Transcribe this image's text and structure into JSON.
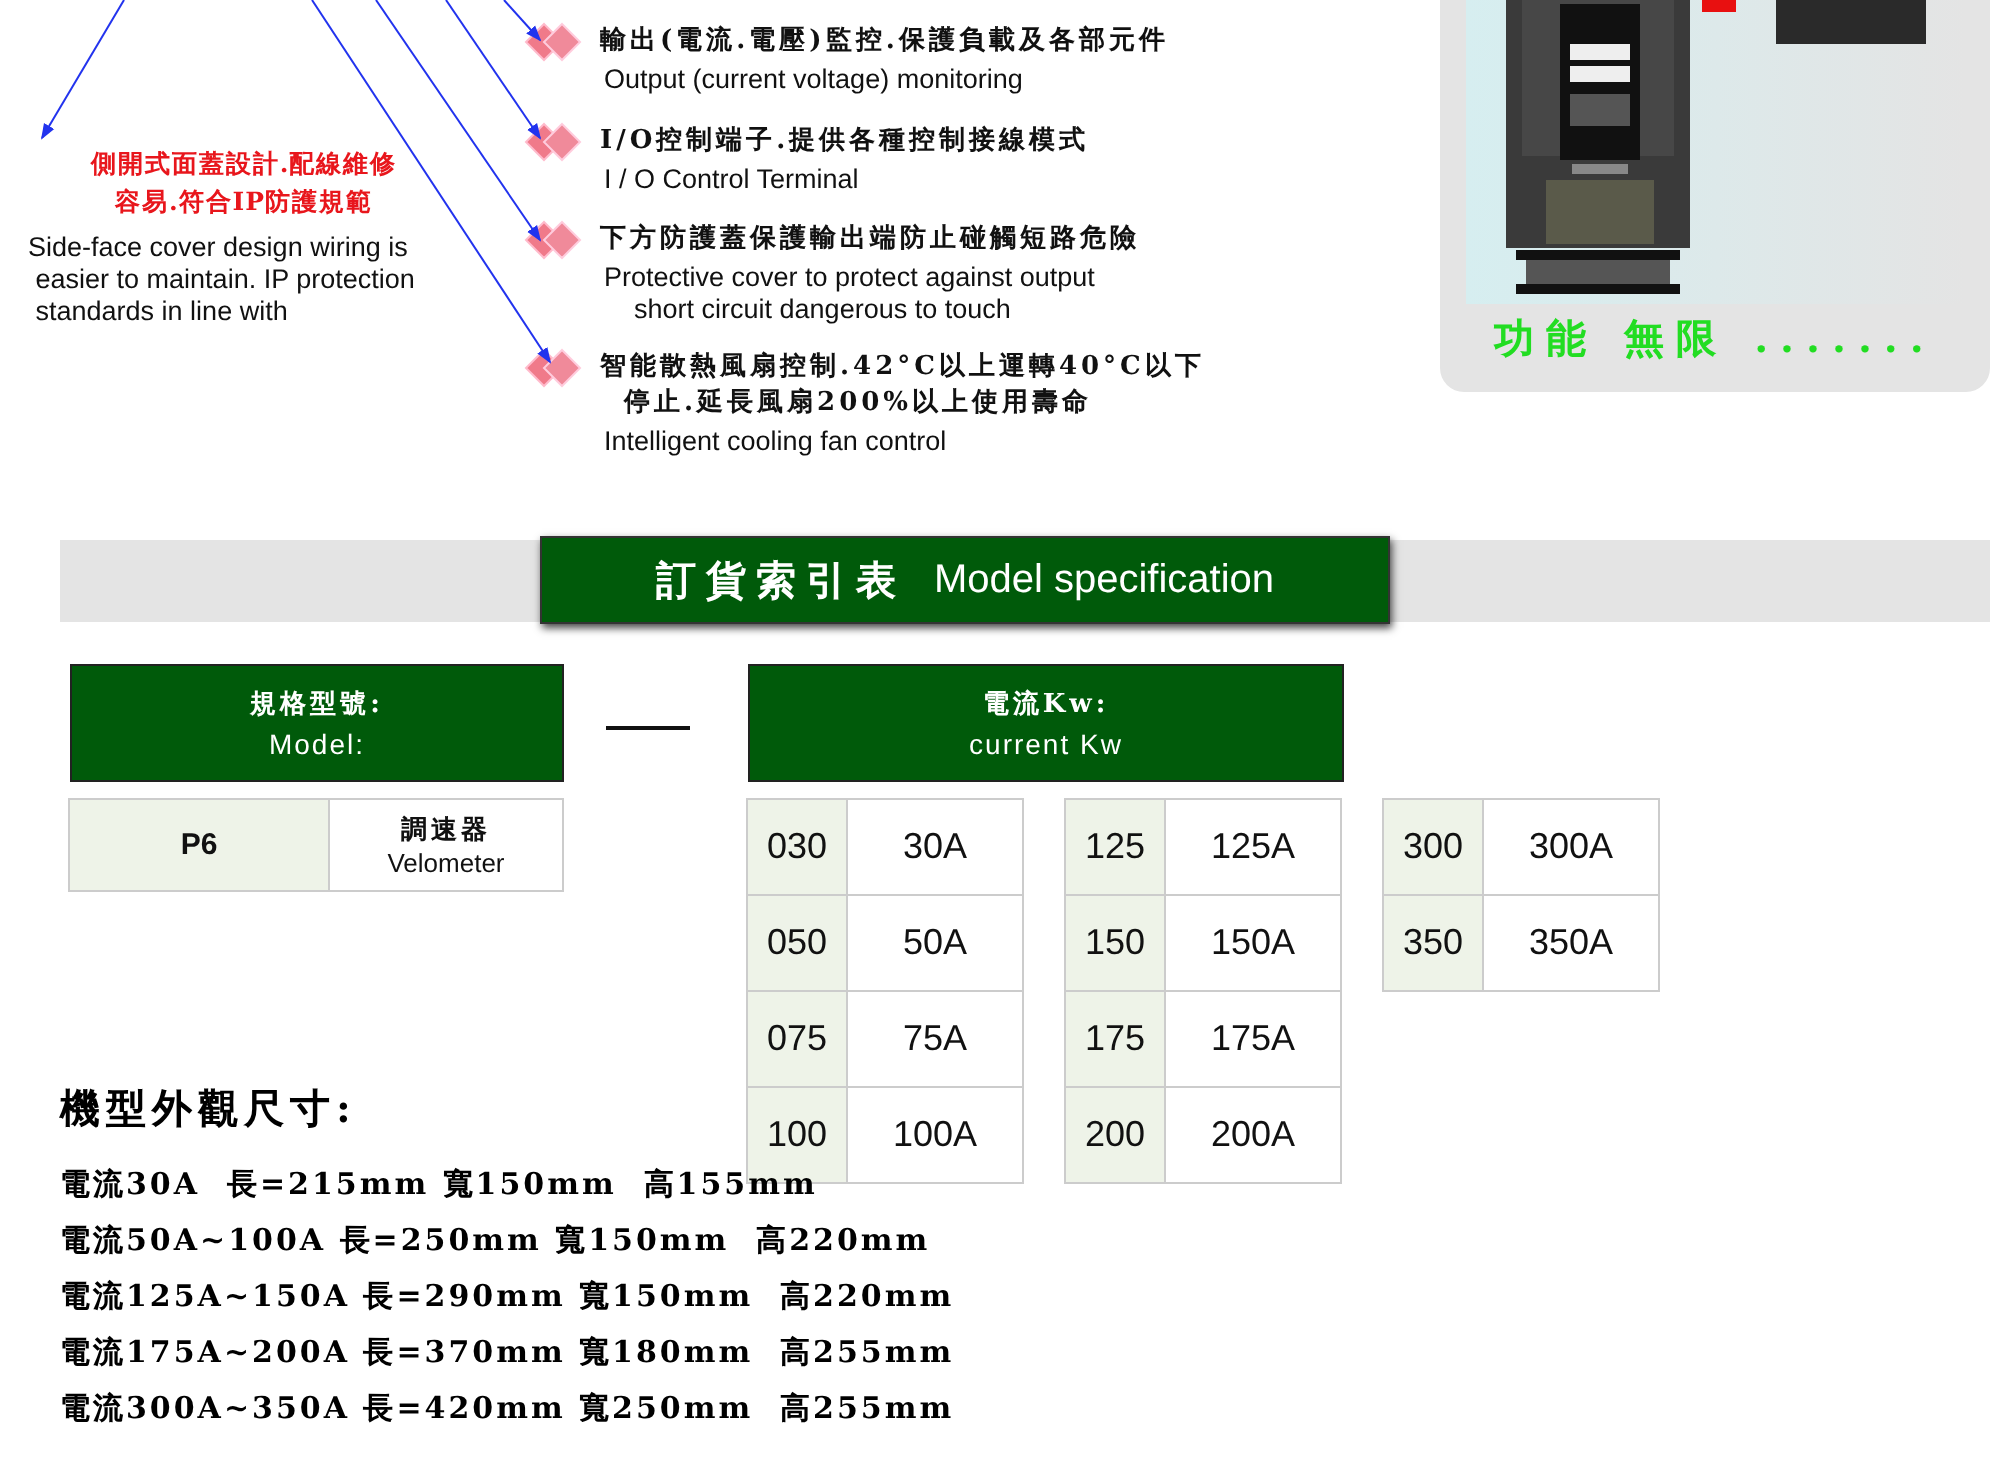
{
  "side_note": {
    "title_lines": [
      "側開式面蓋設計.配線維修",
      "容易.符合IP防護規範"
    ],
    "english": "Side-face cover design wiring is\n easier to maintain. IP protection\n standards in line with"
  },
  "features": [
    {
      "chinese": [
        "輸出(電流.電壓)監控.保護負載及各部元件"
      ],
      "english": "Output (current voltage) monitoring"
    },
    {
      "chinese": [
        "I/O控制端子.提供各種控制接線模式"
      ],
      "english": "I / O Control Terminal"
    },
    {
      "chinese": [
        "下方防護蓋保護輸出端防止碰觸短路危險"
      ],
      "english": "Protective cover to protect against output\n    short circuit dangerous to touch"
    },
    {
      "chinese": [
        "智能散熱風扇控制.42°C以上運轉40°C以下",
        "停止.延長風扇200%以上使用壽命"
      ],
      "english": "Intelligent cooling fan control"
    }
  ],
  "promo_panel": {
    "slogan": "功能 無限",
    "dots": "......."
  },
  "section_title": {
    "chinese": "訂貨索引表",
    "english": "Model specification"
  },
  "model_header": {
    "chinese": "規格型號:",
    "english": "Model:"
  },
  "model_row": {
    "code": "P6",
    "name_chinese": "調速器",
    "name_english": "Velometer"
  },
  "current_header": {
    "chinese": "電流Kw:",
    "english": "current Kw"
  },
  "current_columns": [
    [
      {
        "code": "030",
        "value": "30A"
      },
      {
        "code": "050",
        "value": "50A"
      },
      {
        "code": "075",
        "value": "75A"
      },
      {
        "code": "100",
        "value": "100A"
      }
    ],
    [
      {
        "code": "125",
        "value": "125A"
      },
      {
        "code": "150",
        "value": "150A"
      },
      {
        "code": "175",
        "value": "175A"
      },
      {
        "code": "200",
        "value": "200A"
      }
    ],
    [
      {
        "code": "300",
        "value": "300A"
      },
      {
        "code": "350",
        "value": "350A"
      }
    ]
  ],
  "dimensions": {
    "title": "機型外觀尺寸:",
    "lines": [
      "電流30A  長=215mm 寬150mm  高155mm",
      "電流50A~100A 長=250mm 寬150mm  高220mm",
      "電流125A~150A 長=290mm 寬150mm  高220mm",
      "電流175A~200A 長=370mm 寬180mm  高255mm",
      "電流300A~350A 長=420mm 寬250mm  高255mm"
    ]
  }
}
